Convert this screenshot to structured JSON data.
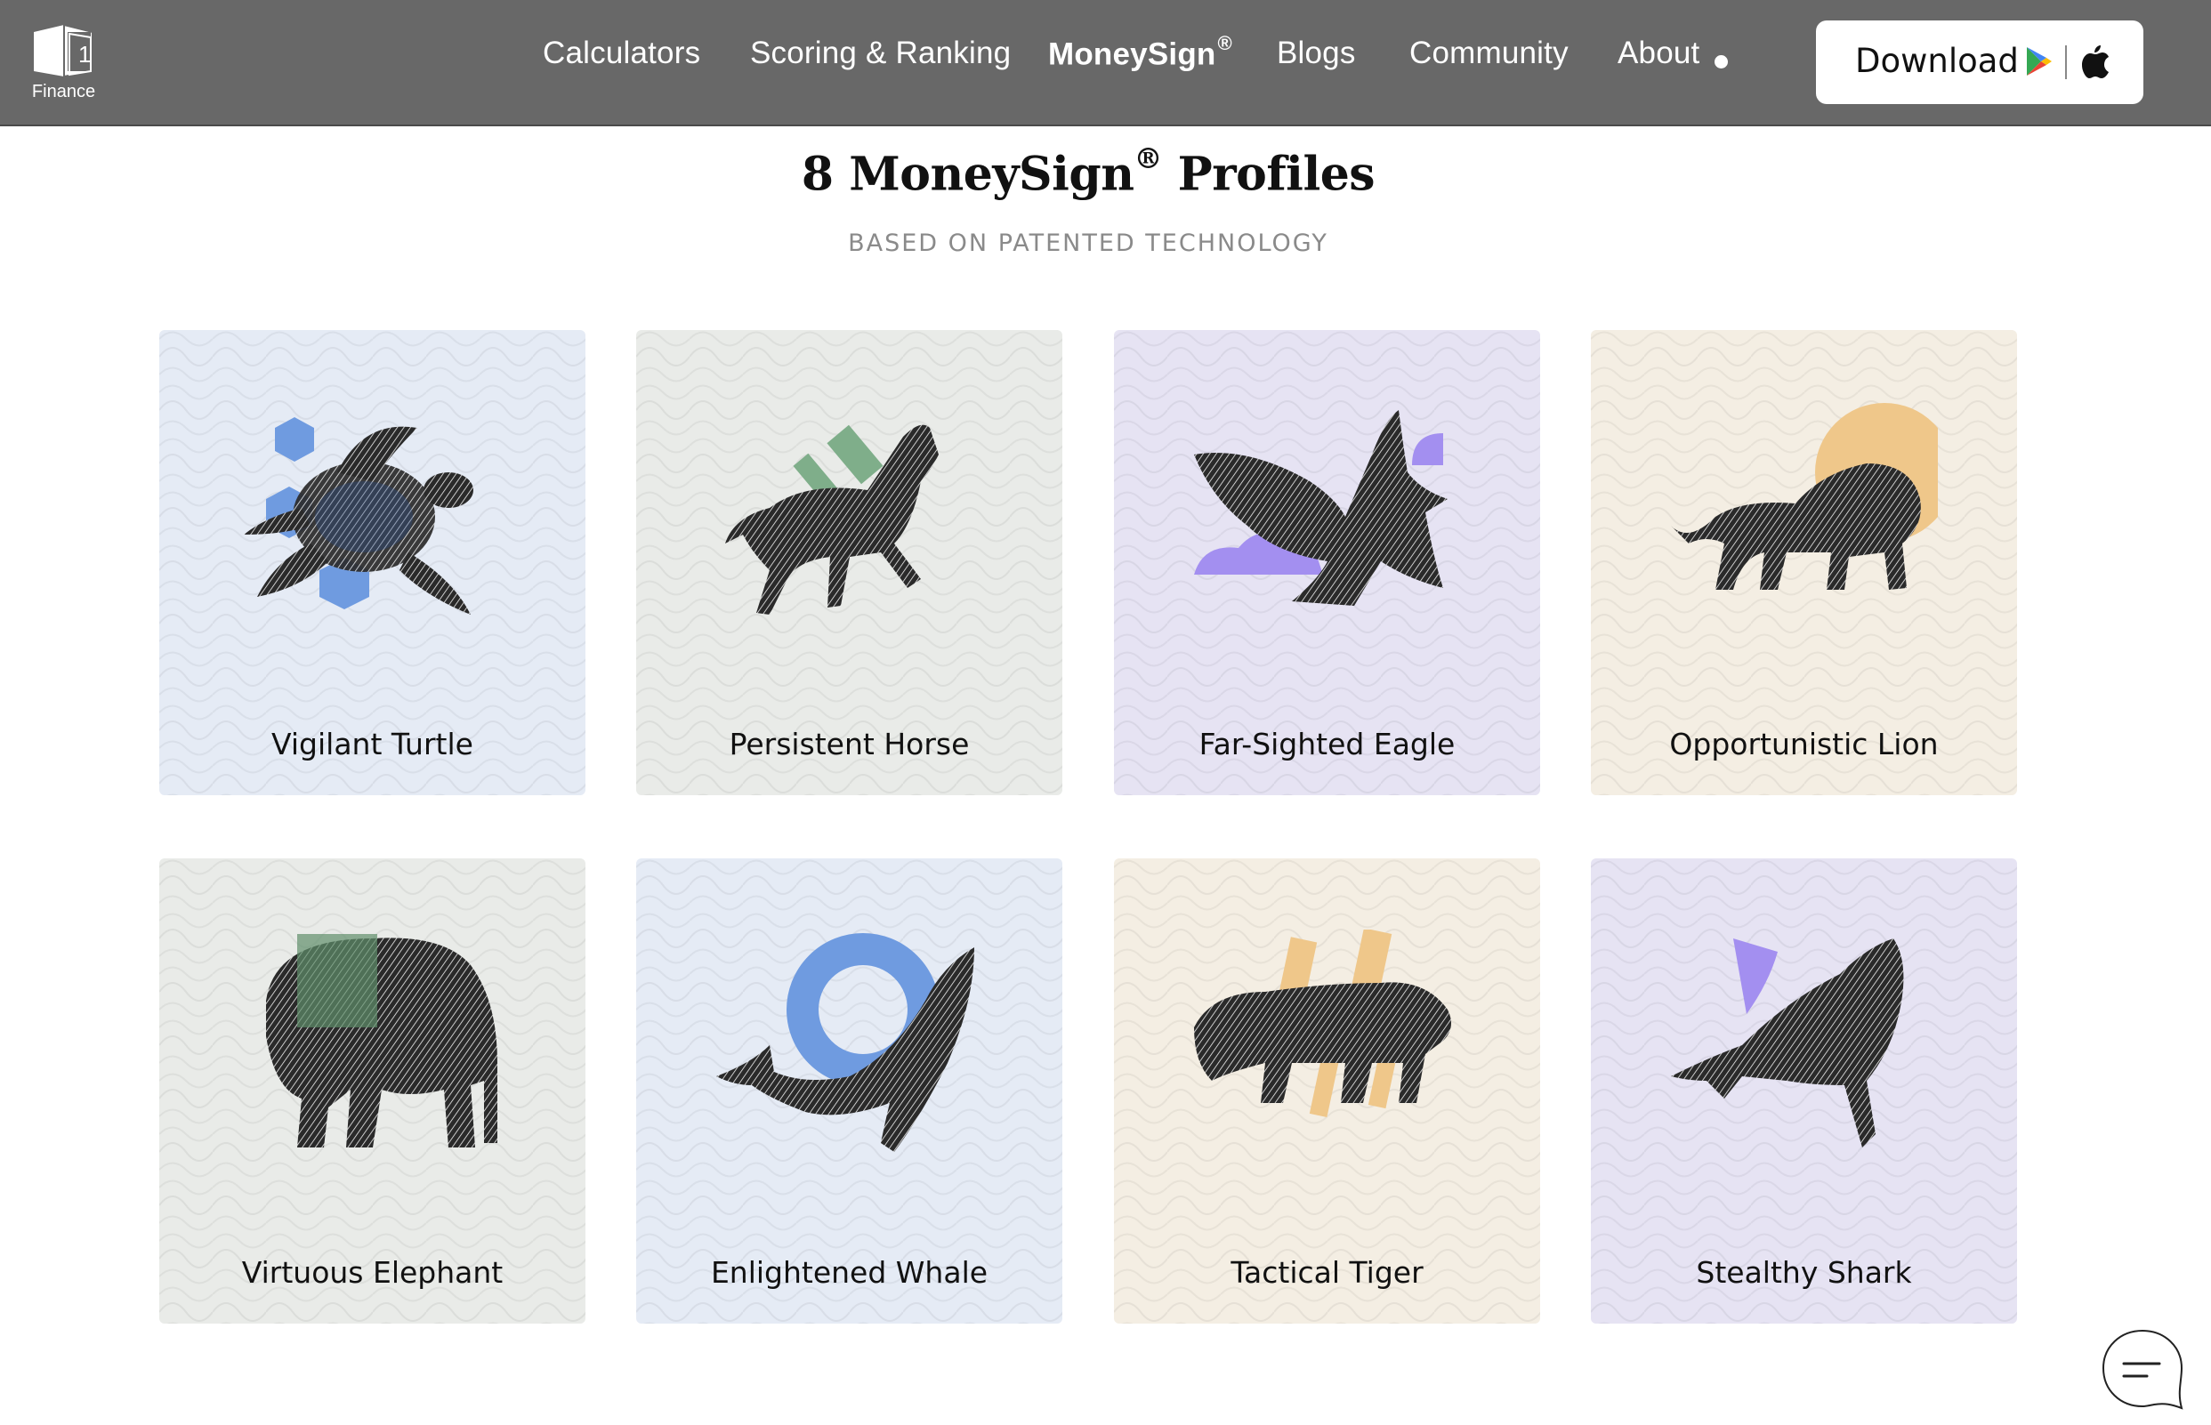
{
  "brand": {
    "logo_digit": "1",
    "logo_text": "Finance"
  },
  "nav": {
    "items": [
      {
        "label": "Calculators"
      },
      {
        "label": "Scoring & Ranking"
      },
      {
        "label": "MoneySign",
        "sup": "®"
      },
      {
        "label": "Blogs"
      },
      {
        "label": "Community"
      },
      {
        "label": "About"
      }
    ],
    "download_label": "Download"
  },
  "section": {
    "title_prefix": "8 MoneySign",
    "title_sup": "®",
    "title_suffix": " Profiles",
    "subtitle": "BASED ON PATENTED TECHNOLOGY"
  },
  "profiles": [
    {
      "name": "Vigilant Turtle",
      "icon": "turtle-icon",
      "accent": "#6f9be0"
    },
    {
      "name": "Persistent Horse",
      "icon": "horse-icon",
      "accent": "#7fae8a"
    },
    {
      "name": "Far-Sighted Eagle",
      "icon": "eagle-icon",
      "accent": "#a38ff0"
    },
    {
      "name": "Opportunistic Lion",
      "icon": "lion-icon",
      "accent": "#efc78a"
    },
    {
      "name": "Virtuous Elephant",
      "icon": "elephant-icon",
      "accent": "#7fa88a"
    },
    {
      "name": "Enlightened Whale",
      "icon": "whale-icon",
      "accent": "#6f9be0"
    },
    {
      "name": "Tactical Tiger",
      "icon": "tiger-icon",
      "accent": "#efc78a"
    },
    {
      "name": "Stealthy Shark",
      "icon": "shark-icon",
      "accent": "#a38ff0"
    }
  ],
  "colors": {
    "header_bg": "#686868",
    "card_blue": "#e5ebf5",
    "card_grey": "#e9ebe8",
    "card_purple": "#e6e3f3",
    "card_cream": "#f4eee3",
    "subtitle": "#8a8a8a"
  }
}
